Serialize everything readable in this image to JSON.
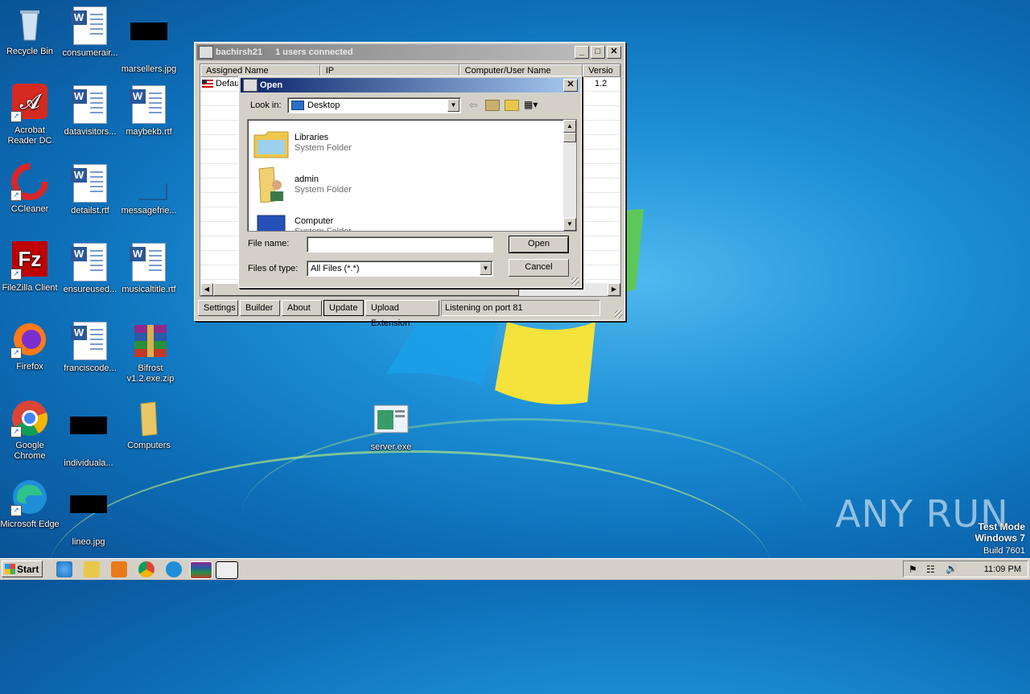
{
  "desktop": {
    "icons": [
      {
        "label": "Recycle Bin"
      },
      {
        "label": "consumerair..."
      },
      {
        "label": "marsellers.jpg"
      },
      {
        "label": "Acrobat Reader DC"
      },
      {
        "label": "datavisitors..."
      },
      {
        "label": "maybekb.rtf"
      },
      {
        "label": "CCleaner"
      },
      {
        "label": "detailst.rtf"
      },
      {
        "label": "messagefrie..."
      },
      {
        "label": "FileZilla Client"
      },
      {
        "label": "ensureused..."
      },
      {
        "label": "musicaltitle.rtf"
      },
      {
        "label": "Firefox"
      },
      {
        "label": "franciscode..."
      },
      {
        "label": "Bifrost v1.2.exe.zip"
      },
      {
        "label": "Google Chrome"
      },
      {
        "label": "individuala..."
      },
      {
        "label": "Computers"
      },
      {
        "label": "Microsoft Edge"
      },
      {
        "label": "lineo.jpg"
      },
      {
        "label": "server.exe"
      }
    ]
  },
  "app_window": {
    "title": "bachirsh21",
    "connected": "1 users connected",
    "columns": [
      "Assigned Name",
      "IP",
      "Computer/User Name",
      "Versio"
    ],
    "row": {
      "name": "Defau",
      "version": "1.2"
    },
    "buttons": [
      "Settings",
      "Builder",
      "About",
      "Update",
      "Upload Extension"
    ],
    "status": "Listening on port 81"
  },
  "open_dialog": {
    "title": "Open",
    "look_in_label": "Look in:",
    "look_in_value": "Desktop",
    "items": [
      {
        "name": "Libraries",
        "type": "System Folder"
      },
      {
        "name": "admin",
        "type": "System Folder"
      },
      {
        "name": "Computer",
        "type": "System Folder"
      }
    ],
    "file_name_label": "File name:",
    "file_name_value": "",
    "files_of_type_label": "Files of type:",
    "files_of_type_value": "All Files (*.*)",
    "open_label": "Open",
    "cancel_label": "Cancel"
  },
  "taskbar": {
    "start_label": "Start",
    "clock": "11:09 PM"
  },
  "watermark": {
    "line1": "Test Mode",
    "line2": "Windows 7",
    "line3": "Build 7601",
    "brand": "ANY RUN"
  }
}
